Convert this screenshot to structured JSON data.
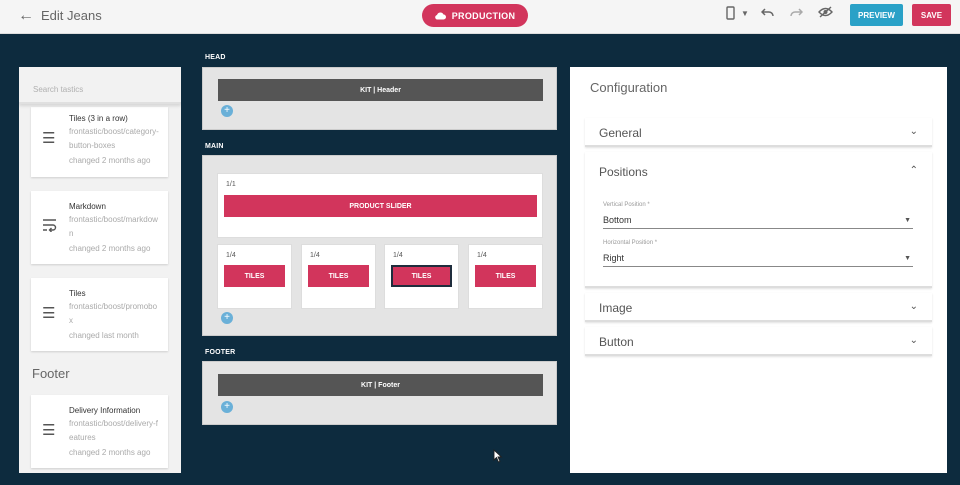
{
  "header": {
    "title": "Edit Jeans",
    "environment": "PRODUCTION",
    "preview_label": "PREVIEW",
    "save_label": "SAVE"
  },
  "sidebar": {
    "search_placeholder": "Search tastics",
    "tastics": [
      {
        "name": "Tiles (3 in a row)",
        "path": "frontastic/boost/category-button-boxes",
        "changed": "changed 2 months ago",
        "icon": "menu-lines-icon"
      },
      {
        "name": "Markdown",
        "path": "frontastic/boost/markdown",
        "changed": "changed 2 months ago",
        "icon": "wrap-text-icon"
      },
      {
        "name": "Tiles",
        "path": "frontastic/boost/promobox",
        "changed": "changed last month",
        "icon": "menu-lines-icon"
      }
    ],
    "footer_heading": "Footer",
    "footer_tastics": [
      {
        "name": "Delivery Information",
        "path": "frontastic/boost/delivery-features",
        "changed": "changed 2 months ago",
        "icon": "menu-lines-icon"
      }
    ]
  },
  "canvas": {
    "head": {
      "label": "HEAD",
      "kit": "KIT | Header"
    },
    "main": {
      "label": "MAIN",
      "slider_ratio": "1/1",
      "slider_label": "PRODUCT SLIDER",
      "tiles": [
        {
          "ratio": "1/4",
          "label": "TILES"
        },
        {
          "ratio": "1/4",
          "label": "TILES"
        },
        {
          "ratio": "1/4",
          "label": "TILES"
        },
        {
          "ratio": "1/4",
          "label": "TILES"
        }
      ]
    },
    "footer": {
      "label": "FOOTER",
      "kit": "KIT | Footer"
    }
  },
  "config": {
    "title": "Configuration",
    "sections": {
      "general": "General",
      "positions": "Positions",
      "image": "Image",
      "button": "Button"
    },
    "vertical_label": "Vertical Position *",
    "vertical_value": "Bottom",
    "horizontal_label": "Horizontal Position *",
    "horizontal_value": "Right"
  }
}
